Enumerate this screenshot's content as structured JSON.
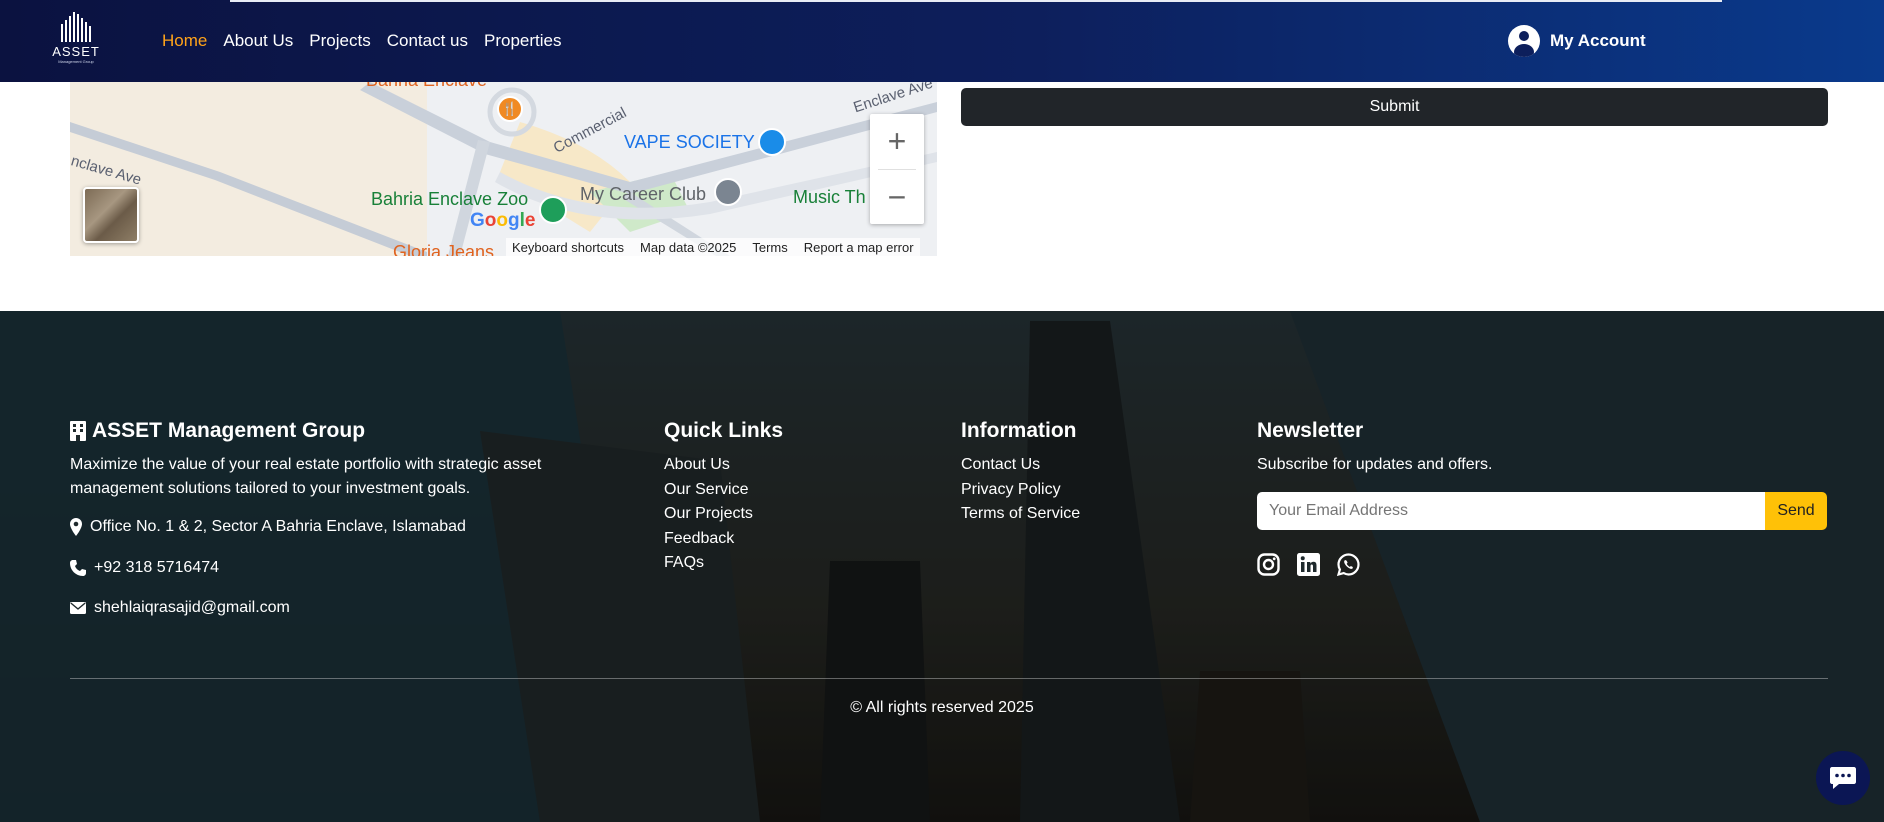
{
  "navbar": {
    "logo_text": "ASSET",
    "logo_subtext": "Management Group",
    "links": [
      "Home",
      "About Us",
      "Projects",
      "Contact us",
      "Properties"
    ],
    "active_link": "Home",
    "account_label": "My Account"
  },
  "map": {
    "places": {
      "restaurant": "Bahria Enclave",
      "vape": "VAPE SOCIETY",
      "zoo": "Bahria Enclave Zoo",
      "career": "My Career Club",
      "music": "Music Th",
      "gloria": "Gloria Jeans"
    },
    "roads": {
      "commercial": "Commercial",
      "enclave_left": "nclave Ave",
      "enclave_right": "Enclave Ave"
    },
    "google_mark": "Google",
    "attribution": [
      "Keyboard shortcuts",
      "Map data ©2025",
      "Terms",
      "Report a map error"
    ],
    "zoom_in": "+",
    "zoom_out": "−"
  },
  "form": {
    "submit_label": "Submit"
  },
  "footer": {
    "company": {
      "title": "ASSET Management Group",
      "description": "Maximize the value of your real estate portfolio with strategic asset management solutions tailored to your investment goals.",
      "address": "Office No. 1 & 2, Sector A Bahria Enclave, Islamabad",
      "phone": "+92 318 5716474",
      "email": "shehlaiqrasajid@gmail.com"
    },
    "quick_links": {
      "title": "Quick Links",
      "items": [
        "About Us",
        "Our Service",
        "Our Projects",
        "Feedback",
        "FAQs"
      ]
    },
    "information": {
      "title": "Information",
      "items": [
        "Contact Us",
        "Privacy Policy",
        "Terms of Service"
      ]
    },
    "newsletter": {
      "title": "Newsletter",
      "subtitle": "Subscribe for updates and offers.",
      "placeholder": "Your Email Address",
      "send_label": "Send"
    },
    "socials": [
      "instagram-icon",
      "linkedin-icon",
      "whatsapp-icon"
    ],
    "copyright": "© All rights reserved 2025"
  },
  "colors": {
    "nav_start": "#0b1240",
    "nav_end": "#0a3a8c",
    "active_link": "#ffa31a",
    "submit_bg": "#212529",
    "send_bg": "#ffc107",
    "chat_bg": "#0b1654"
  }
}
